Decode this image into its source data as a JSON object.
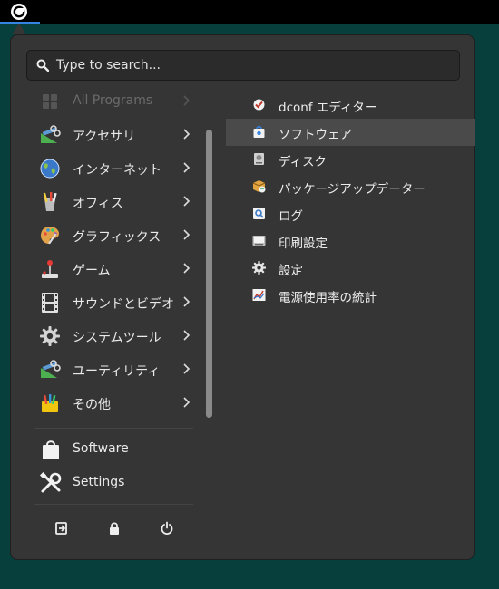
{
  "search": {
    "placeholder": "Type to search..."
  },
  "categories": [
    {
      "label": "All Programs",
      "icon": "grid-icon",
      "enabled": false
    },
    {
      "label": "アクセサリ",
      "icon": "accessories-icon",
      "enabled": true
    },
    {
      "label": "インターネット",
      "icon": "globe-icon",
      "enabled": true
    },
    {
      "label": "オフィス",
      "icon": "office-icon",
      "enabled": true
    },
    {
      "label": "グラフィックス",
      "icon": "palette-icon",
      "enabled": true
    },
    {
      "label": "ゲーム",
      "icon": "joystick-icon",
      "enabled": true
    },
    {
      "label": "サウンドとビデオ",
      "icon": "film-icon",
      "enabled": true
    },
    {
      "label": "システムツール",
      "icon": "gear-icon",
      "enabled": true
    },
    {
      "label": "ユーティリティ",
      "icon": "utilities-icon",
      "enabled": true
    },
    {
      "label": "その他",
      "icon": "other-icon",
      "enabled": true
    }
  ],
  "places": [
    {
      "label": "Software",
      "icon": "shopping-bag-icon"
    },
    {
      "label": "Settings",
      "icon": "tools-icon"
    }
  ],
  "actions": [
    {
      "name": "logout",
      "icon": "logout-icon"
    },
    {
      "name": "lock",
      "icon": "lock-icon"
    },
    {
      "name": "power",
      "icon": "power-icon"
    }
  ],
  "apps": [
    {
      "label": "dconf エディター",
      "icon": "dconf-icon",
      "selected": false
    },
    {
      "label": "ソフトウェア",
      "icon": "software-icon",
      "selected": true
    },
    {
      "label": "ディスク",
      "icon": "disk-icon",
      "selected": false
    },
    {
      "label": "パッケージアップデーター",
      "icon": "package-updater-icon",
      "selected": false
    },
    {
      "label": "ログ",
      "icon": "logs-icon",
      "selected": false
    },
    {
      "label": "印刷設定",
      "icon": "printer-icon",
      "selected": false
    },
    {
      "label": "設定",
      "icon": "settings-gear-icon",
      "selected": false
    },
    {
      "label": "電源使用率の統計",
      "icon": "power-stats-icon",
      "selected": false
    }
  ],
  "colors": {
    "desktop": "#063f3c",
    "menu_bg": "#353535",
    "accent": "#3584e4",
    "selected_row": "#4a4a4a"
  }
}
